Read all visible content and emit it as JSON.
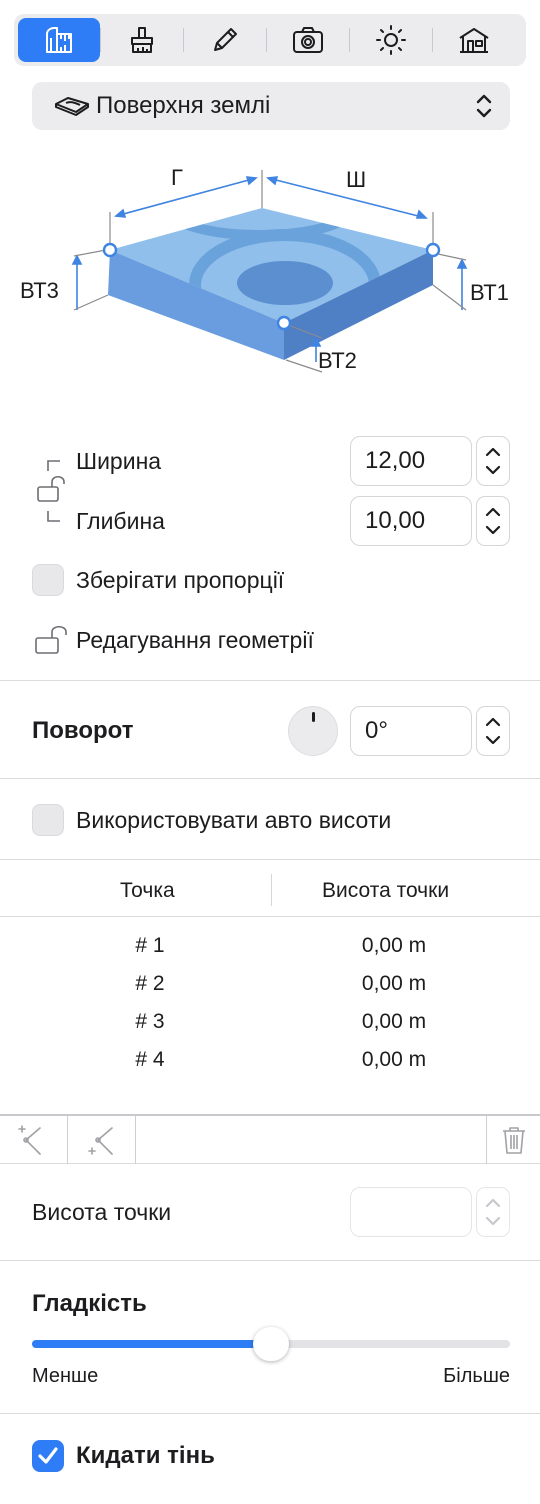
{
  "toolbar": {
    "tabs": [
      {
        "name": "measure",
        "icon": "ruler-triangle-icon",
        "active": true
      },
      {
        "name": "texture",
        "icon": "paint-brush-icon",
        "active": false
      },
      {
        "name": "edit",
        "icon": "pencil-icon",
        "active": false
      },
      {
        "name": "camera",
        "icon": "camera-icon",
        "active": false
      },
      {
        "name": "light",
        "icon": "sun-icon",
        "active": false
      },
      {
        "name": "building",
        "icon": "house-icon",
        "active": false
      }
    ],
    "accent": "#2e7cf6"
  },
  "surface_select": {
    "icon": "terrain-icon",
    "value": "Поверхня землі"
  },
  "diagram": {
    "label_depth": "Г",
    "label_width": "Ш",
    "label_bt1": "ВТ1",
    "label_bt2": "ВТ2",
    "label_bt3": "ВТ3"
  },
  "dimensions": {
    "width_label": "Ширина",
    "width_value": "12,00",
    "depth_label": "Глибина",
    "depth_value": "10,00",
    "keep_proportions_label": "Зберігати пропорції",
    "keep_proportions": false,
    "edit_geometry_label": "Редагування геометрії"
  },
  "rotation": {
    "label": "Поворот",
    "value": "0°"
  },
  "auto_heights": {
    "label": "Використовувати авто висоти",
    "checked": false
  },
  "points_table": {
    "col_point": "Точка",
    "col_height": "Висота точки",
    "rows": [
      {
        "point": "# 1",
        "height": "0,00 m"
      },
      {
        "point": "# 2",
        "height": "0,00 m"
      },
      {
        "point": "# 3",
        "height": "0,00 m"
      },
      {
        "point": "# 4",
        "height": "0,00 m"
      }
    ]
  },
  "point_height": {
    "label": "Висота точки",
    "value": ""
  },
  "smoothness": {
    "label": "Гладкість",
    "min_label": "Менше",
    "max_label": "Більше",
    "level": 0.5
  },
  "cast_shadow": {
    "label": "Кидати тінь",
    "checked": true
  }
}
